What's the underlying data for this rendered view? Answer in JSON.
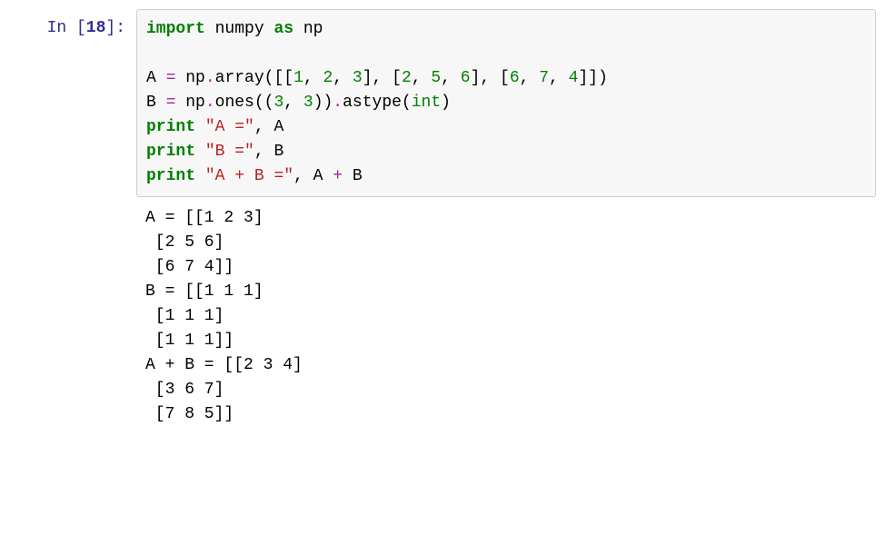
{
  "prompt": {
    "inLabel": "In ",
    "openBracket": "[",
    "execCount": "18",
    "closeBracket": "]:"
  },
  "code": {
    "l1": {
      "kw1": "import",
      "sp1": " ",
      "mod": "numpy",
      "sp2": " ",
      "kw2": "as",
      "sp3": " ",
      "alias": "np"
    },
    "l2": {
      "p1": "A ",
      "op1": "=",
      "p2": " np",
      "op2": ".",
      "p3": "array([[",
      "n1": "1",
      "p4": ", ",
      "n2": "2",
      "p5": ", ",
      "n3": "3",
      "p6": "], [",
      "n4": "2",
      "p7": ", ",
      "n5": "5",
      "p8": ", ",
      "n6": "6",
      "p9": "], [",
      "n7": "6",
      "p10": ", ",
      "n8": "7",
      "p11": ", ",
      "n9": "4",
      "p12": "]])"
    },
    "l3": {
      "p1": "B ",
      "op1": "=",
      "p2": " np",
      "op2": ".",
      "p3": "ones((",
      "n1": "3",
      "p4": ", ",
      "n2": "3",
      "p5": "))",
      "op3": ".",
      "p6": "astype(",
      "builtin": "int",
      "p7": ")"
    },
    "l4": {
      "kw": "print",
      "sp": " ",
      "str": "\"A =\"",
      "p1": ", A"
    },
    "l5": {
      "kw": "print",
      "sp": " ",
      "str": "\"B =\"",
      "p1": ", B"
    },
    "l6": {
      "kw": "print",
      "sp": " ",
      "str": "\"A + B =\"",
      "p1": ", A ",
      "op": "+",
      "p2": " B"
    }
  },
  "output": "A = [[1 2 3]\n [2 5 6]\n [6 7 4]]\nB = [[1 1 1]\n [1 1 1]\n [1 1 1]]\nA + B = [[2 3 4]\n [3 6 7]\n [7 8 5]]"
}
